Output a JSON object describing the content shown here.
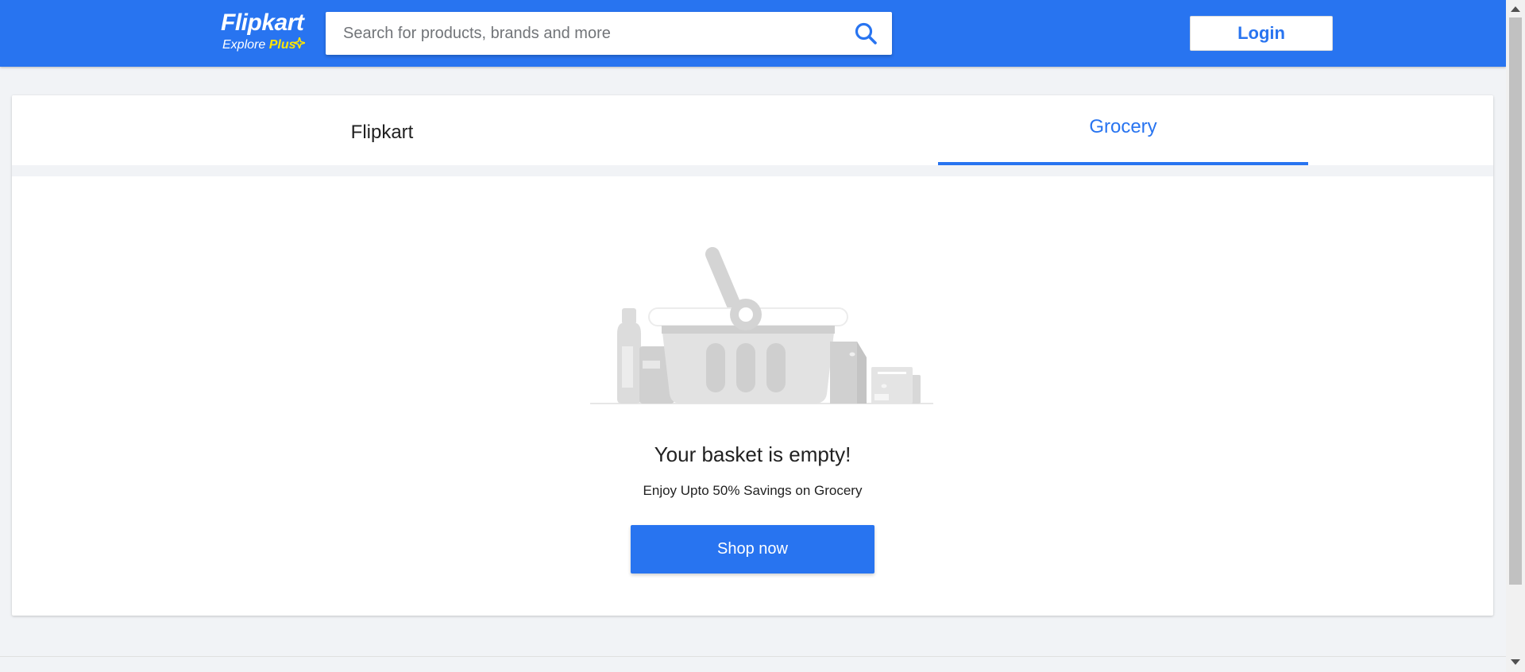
{
  "header": {
    "logo": {
      "brand": "Flipkart",
      "tagline_prefix": "Explore",
      "tagline_plus": "Plus"
    },
    "search": {
      "placeholder": "Search for products, brands and more",
      "value": ""
    },
    "login_label": "Login"
  },
  "tabs": [
    {
      "label": "Flipkart",
      "active": false
    },
    {
      "label": "Grocery",
      "active": true
    }
  ],
  "empty_state": {
    "title": "Your basket is empty!",
    "subtitle": "Enjoy Upto 50% Savings on Grocery",
    "cta_label": "Shop now",
    "illustration": "empty-basket-icon"
  },
  "colors": {
    "brand_blue": "#2874f0",
    "plus_yellow": "#ffe500",
    "page_bg": "#f1f3f6"
  }
}
